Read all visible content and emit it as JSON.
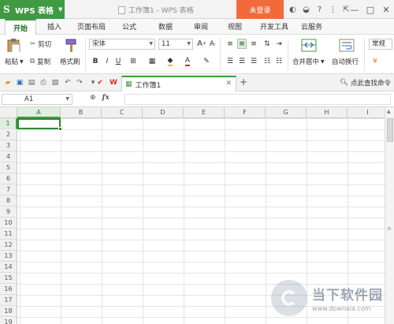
{
  "titlebar": {
    "app_name": "WPS 表格",
    "window_title": "工作簿1 - WPS 表格",
    "login_label": "未登录",
    "win_min": "—",
    "win_max": "□",
    "win_close": "✕"
  },
  "ribbon_tabs": [
    "开始",
    "插入",
    "页面布局",
    "公式",
    "数据",
    "审阅",
    "视图",
    "开发工具",
    "云服务"
  ],
  "ribbon": {
    "paste_label": "粘贴",
    "cut_label": "剪切",
    "copy_label": "复制",
    "format_painter_label": "格式刷",
    "font_name": "宋体",
    "font_size": "11",
    "bold": "B",
    "italic": "I",
    "underline": "U",
    "merge_center_label": "合并居中",
    "wrap_text_label": "自动换行",
    "number_format": "常规"
  },
  "doc_tabs": [
    {
      "label": "工作簿1"
    }
  ],
  "find_label": "点此查找命令",
  "formula_bar": {
    "name_box": "A1",
    "fx_label": "fx"
  },
  "columns": [
    "A",
    "B",
    "C",
    "D",
    "E",
    "F",
    "G",
    "H",
    "I"
  ],
  "rows": [
    "1",
    "2",
    "3",
    "4",
    "5",
    "6",
    "7",
    "8",
    "9",
    "10",
    "11",
    "12",
    "13",
    "14",
    "15",
    "16",
    "17",
    "18",
    "19"
  ],
  "selected_cell": "A1",
  "watermark": {
    "title": "当下软件园",
    "url": "www.downxia.com"
  },
  "colors": {
    "accent_green": "#3f9a43",
    "login_orange": "#f26a3c"
  }
}
